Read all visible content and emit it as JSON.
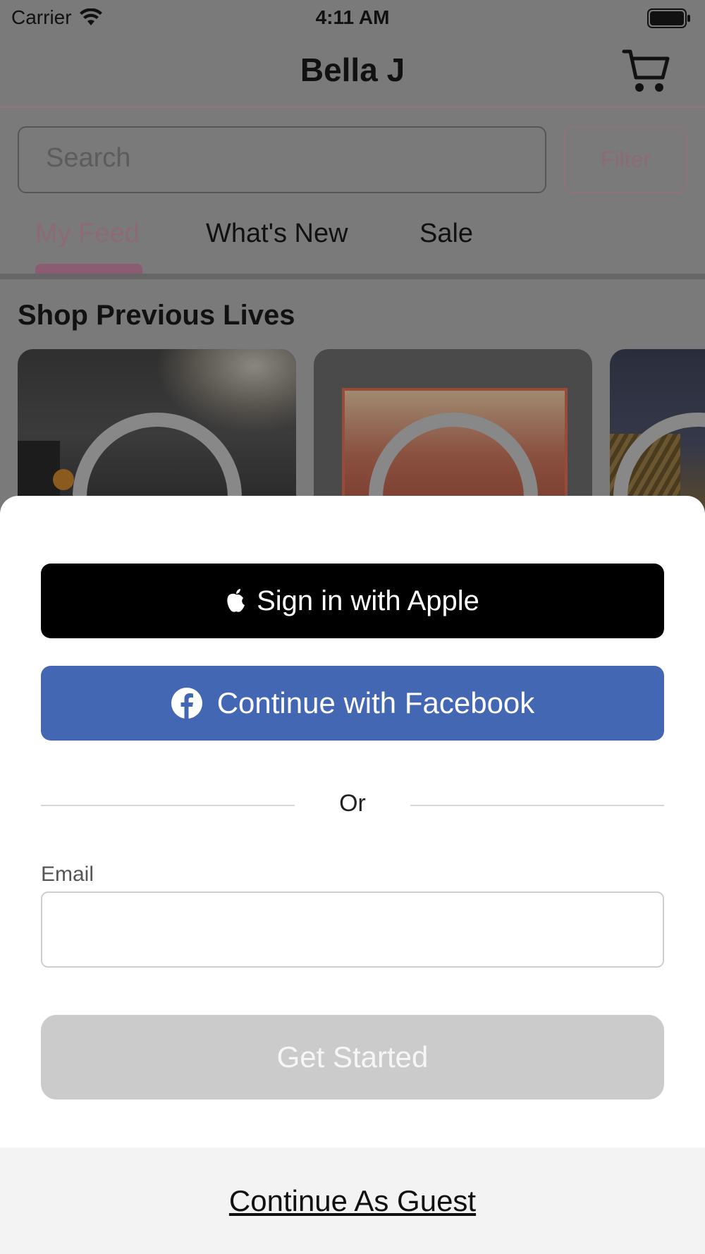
{
  "status_bar": {
    "carrier": "Carrier",
    "time": "4:11 AM"
  },
  "header": {
    "title": "Bella J"
  },
  "search": {
    "placeholder": "Search"
  },
  "filter": {
    "label": "Filter"
  },
  "tabs": [
    {
      "label": "My Feed",
      "active": true
    },
    {
      "label": "What's New",
      "active": false
    },
    {
      "label": "Sale",
      "active": false
    }
  ],
  "section": {
    "title": "Shop Previous Lives"
  },
  "sheet": {
    "apple_label": "Sign in with Apple",
    "facebook_label": "Continue with Facebook",
    "or_label": "Or",
    "email_label": "Email",
    "email_value": "",
    "get_started_label": "Get Started",
    "guest_label": "Continue As Guest"
  },
  "colors": {
    "accent_pink": "#E6A9C5",
    "facebook_blue": "#4467B3",
    "disabled_button": "#CBCBCB"
  },
  "icons": [
    "wifi-icon",
    "battery-icon",
    "cart-icon",
    "play-icon",
    "apple-icon",
    "facebook-icon"
  ]
}
